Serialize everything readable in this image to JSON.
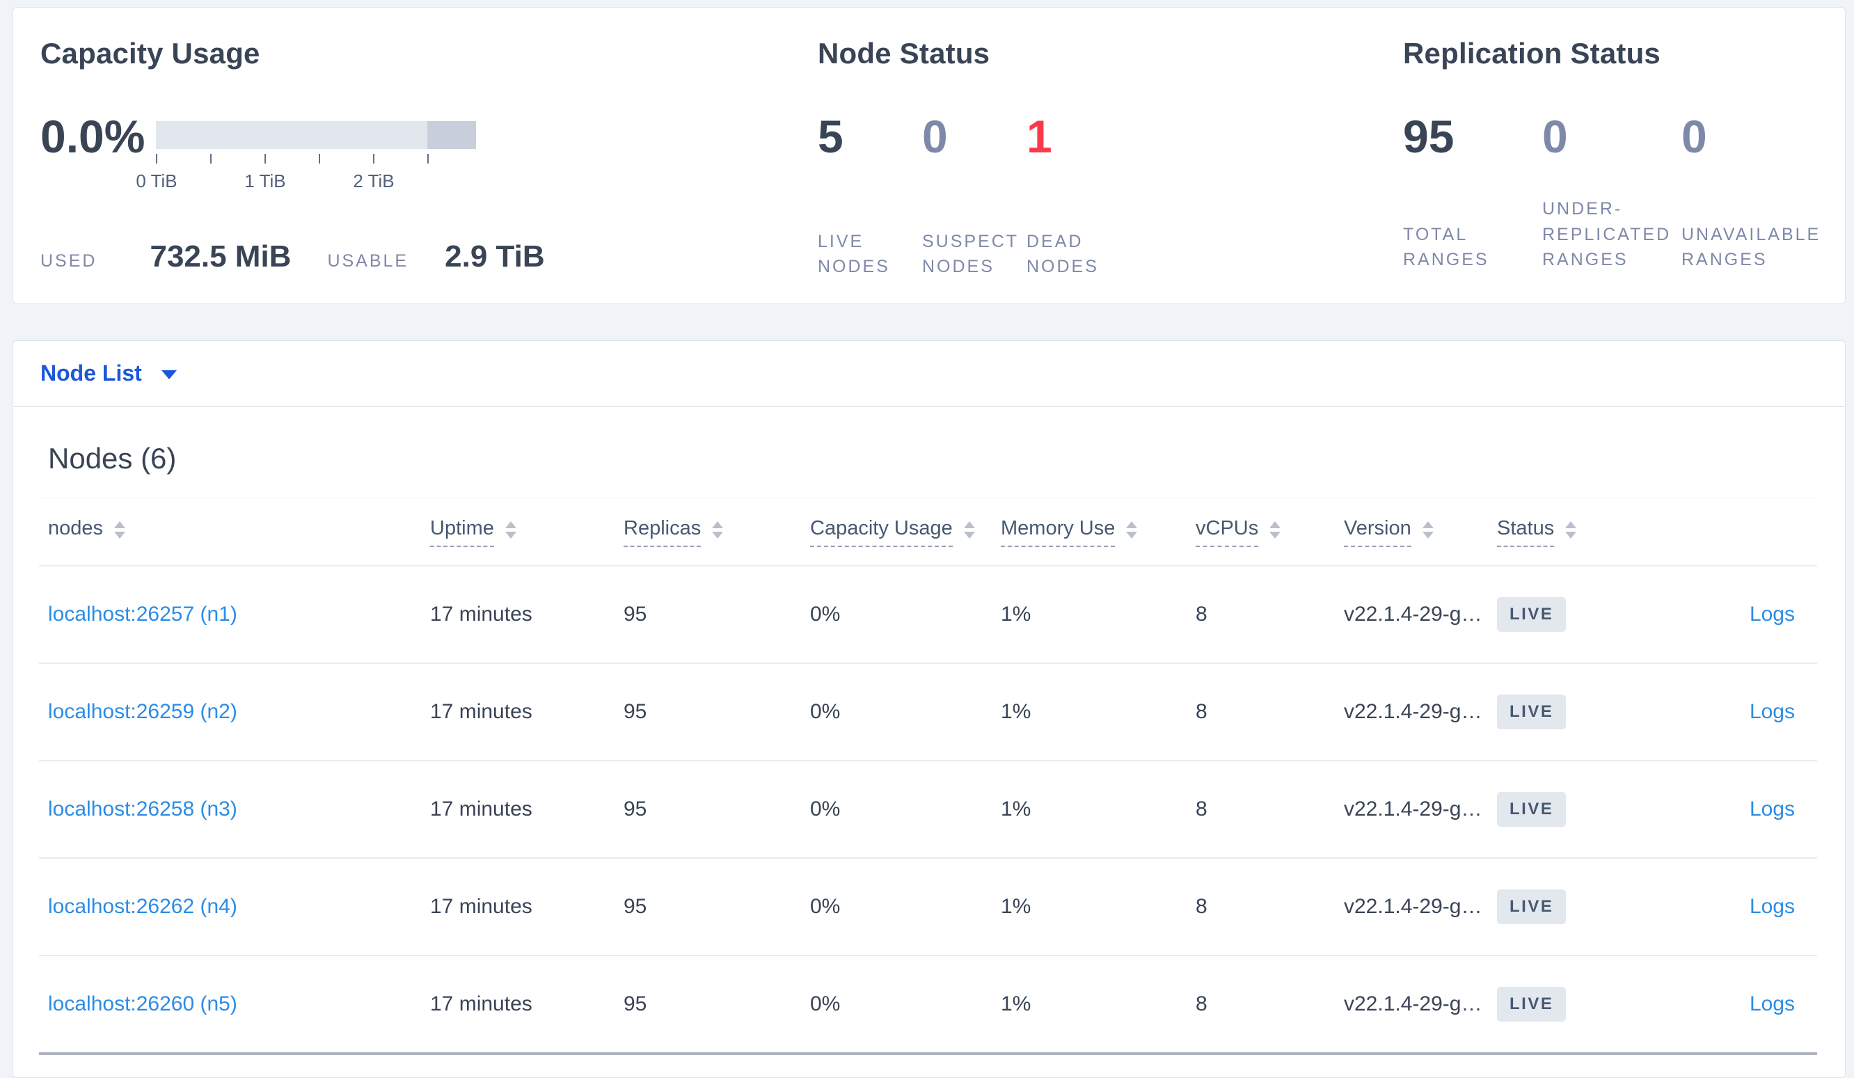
{
  "colors": {
    "accent_blue": "#1b57dd",
    "table_link_blue": "#2b8ce6",
    "dead_red": "#fb394c",
    "muted_slate": "#7e89a9",
    "dark_slate": "#394455",
    "bar_light": "#e2e6ed",
    "bar_dark": "#c9cfda",
    "badge_bg": "#e3e8ef"
  },
  "summary": {
    "capacity": {
      "title": "Capacity Usage",
      "percent": "0.0%",
      "ticks": [
        "0 TiB",
        "1 TiB",
        "2 TiB"
      ],
      "bar": {
        "max_tib": 2.95,
        "dark_segment_from_tib": 2.5,
        "tick_step_tib": 0.5
      },
      "used_label": "USED",
      "used_value": "732.5 MiB",
      "usable_label": "USABLE",
      "usable_value": "2.9 TiB"
    },
    "node_status": {
      "title": "Node Status",
      "stats": [
        {
          "value": "5",
          "label": "LIVE NODES",
          "color": "#394455"
        },
        {
          "value": "0",
          "label": "SUSPECT NODES",
          "color": "#7e89a9"
        },
        {
          "value": "1",
          "label": "DEAD NODES",
          "color": "#fb394c"
        }
      ]
    },
    "replication": {
      "title": "Replication Status",
      "stats": [
        {
          "value": "95",
          "label": "TOTAL RANGES",
          "color": "#394455"
        },
        {
          "value": "0",
          "label": "UNDER-REPLICATED RANGES",
          "color": "#7e89a9"
        },
        {
          "value": "0",
          "label": "UNAVAILABLE RANGES",
          "color": "#7e89a9"
        }
      ]
    }
  },
  "nodelist": {
    "dropdown_label": "Node List",
    "section_title": "Nodes (6)",
    "table": {
      "columns": [
        {
          "key": "nodes",
          "label": "nodes",
          "sortable": true,
          "underline": false
        },
        {
          "key": "uptime",
          "label": "Uptime",
          "sortable": true,
          "underline": true
        },
        {
          "key": "replicas",
          "label": "Replicas",
          "sortable": true,
          "underline": true
        },
        {
          "key": "capacity",
          "label": "Capacity Usage",
          "sortable": true,
          "underline": true
        },
        {
          "key": "memory",
          "label": "Memory Use",
          "sortable": true,
          "underline": true
        },
        {
          "key": "vcpus",
          "label": "vCPUs",
          "sortable": true,
          "underline": true
        },
        {
          "key": "version",
          "label": "Version",
          "sortable": true,
          "underline": true
        },
        {
          "key": "status",
          "label": "Status",
          "sortable": true,
          "underline": true
        },
        {
          "key": "logs",
          "label": "",
          "sortable": false,
          "underline": false
        }
      ],
      "rows": [
        {
          "nodes": "localhost:26257 (n1)",
          "uptime": "17 minutes",
          "replicas": "95",
          "capacity": "0%",
          "memory": "1%",
          "vcpus": "8",
          "version": "v22.1.4-29-g…",
          "status": "LIVE",
          "logs": "Logs"
        },
        {
          "nodes": "localhost:26259 (n2)",
          "uptime": "17 minutes",
          "replicas": "95",
          "capacity": "0%",
          "memory": "1%",
          "vcpus": "8",
          "version": "v22.1.4-29-g…",
          "status": "LIVE",
          "logs": "Logs"
        },
        {
          "nodes": "localhost:26258 (n3)",
          "uptime": "17 minutes",
          "replicas": "95",
          "capacity": "0%",
          "memory": "1%",
          "vcpus": "8",
          "version": "v22.1.4-29-g…",
          "status": "LIVE",
          "logs": "Logs"
        },
        {
          "nodes": "localhost:26262 (n4)",
          "uptime": "17 minutes",
          "replicas": "95",
          "capacity": "0%",
          "memory": "1%",
          "vcpus": "8",
          "version": "v22.1.4-29-g…",
          "status": "LIVE",
          "logs": "Logs"
        },
        {
          "nodes": "localhost:26260 (n5)",
          "uptime": "17 minutes",
          "replicas": "95",
          "capacity": "0%",
          "memory": "1%",
          "vcpus": "8",
          "version": "v22.1.4-29-g…",
          "status": "LIVE",
          "logs": "Logs"
        }
      ]
    }
  }
}
